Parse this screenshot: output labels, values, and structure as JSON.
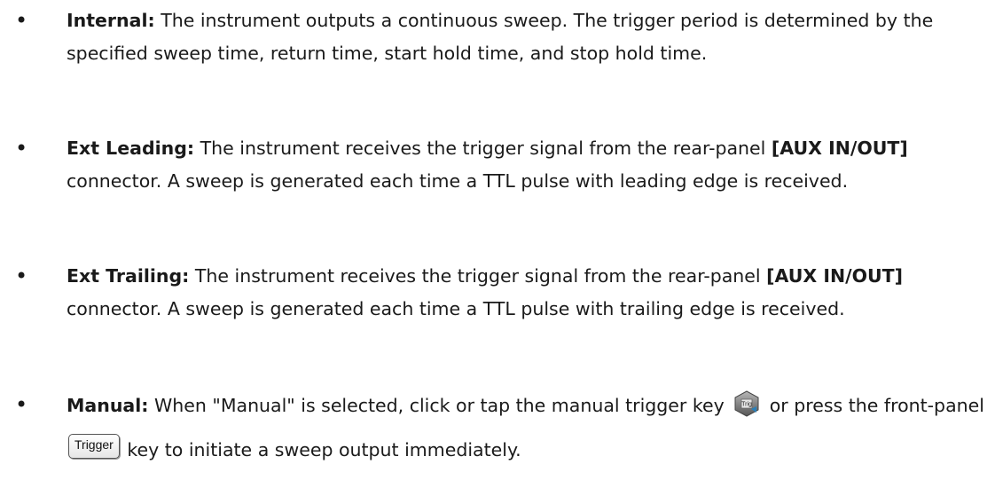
{
  "items": [
    {
      "label": "Internal:",
      "text": " The instrument outputs a continuous sweep. The trigger period is determined by the specified sweep time, return time, start hold time, and stop hold time."
    },
    {
      "label": "Ext Leading:",
      "text_before": " The instrument receives the trigger signal from the rear-panel ",
      "connector": "[AUX IN/OUT]",
      "text_after": " connector. A sweep is generated each time a TTL pulse with leading edge is received."
    },
    {
      "label": "Ext Trailing:",
      "text_before": " The instrument receives the trigger signal from the rear-panel ",
      "connector": "[AUX IN/OUT]",
      "text_after": " connector. A sweep is generated each time a TTL pulse with trailing edge is received."
    },
    {
      "label": "Manual:",
      "text_before": " When \"Manual\" is selected, click or tap the manual trigger key ",
      "trig_icon_text": "Trig",
      "text_middle": " or press the front-panel ",
      "key_label": "Trigger",
      "text_after": " key to initiate a sweep output immediately."
    }
  ],
  "bullet_char": "•",
  "icons": {
    "trig": "trigger-soft-key-icon",
    "trigger_key": "trigger-front-panel-key-icon"
  },
  "colors": {
    "text": "#1a1a1a",
    "icon_face": "#7a7a7a",
    "icon_badge": "#2a7fb8"
  }
}
